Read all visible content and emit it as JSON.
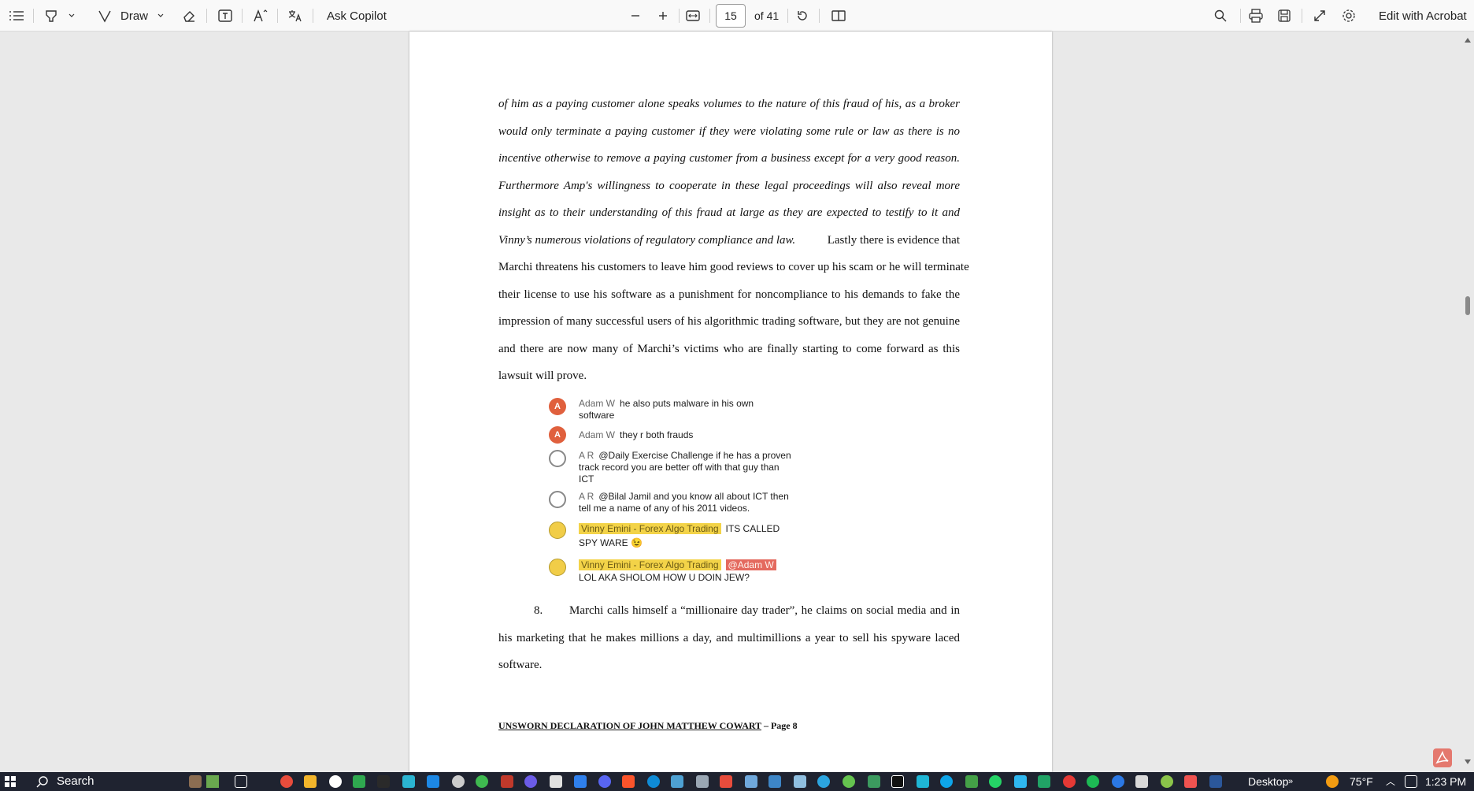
{
  "toolbar": {
    "draw_label": "Draw",
    "ask_copilot_label": "Ask Copilot",
    "page_number": "15",
    "page_total": "of 41",
    "edit_acrobat_label": "Edit with Acrobat"
  },
  "document": {
    "paragraph_lines": [
      {
        "text": "of him as a paying customer alone speaks volumes to the nature of this fraud of his, as a broker",
        "italic": true
      },
      {
        "text": "would only terminate a paying customer if they were violating some rule or law as there is no",
        "italic": true
      },
      {
        "text": "incentive otherwise to remove a paying customer from a business except for a very good reason.",
        "italic": true
      },
      {
        "text": "Furthermore Amp's willingness to cooperate in these legal proceedings will also reveal more",
        "italic": true
      },
      {
        "text": "insight as to their understanding of this fraud at large as they are expected to testify to it and",
        "italic": true
      }
    ],
    "mixed_line": {
      "italic_part": "Vinny’s numerous violations of regulatory compliance and law.",
      "normal_part": "Lastly there is evidence that"
    },
    "paragraph_lines_2": [
      "Marchi threatens his customers to leave him good reviews to cover up his scam or he will terminate",
      "their license to use his software as a punishment for noncompliance to his demands to fake the",
      "impression of many successful users of his algorithmic trading software, but they are not genuine",
      "and there are now many of Marchi’s victims who are finally starting to come forward as this",
      "lawsuit will prove."
    ],
    "chat": [
      {
        "avatar": "A",
        "avatar_style": "orange",
        "name": "Adam W",
        "lines": [
          "he also puts malware in his own",
          "software"
        ]
      },
      {
        "avatar": "A",
        "avatar_style": "orange",
        "name": "Adam W",
        "lines": [
          "they r both frauds"
        ]
      },
      {
        "avatar": "",
        "avatar_style": "ring",
        "name": "A R",
        "lines": [
          "@Daily Exercise Challenge if he has a proven",
          "track record you are better off with that guy than",
          "ICT"
        ]
      },
      {
        "avatar": "",
        "avatar_style": "ring",
        "name": "A R",
        "lines": [
          "@Bilal Jamil and you know all about ICT then",
          "tell me a name of any of his 2011 videos."
        ]
      },
      {
        "avatar": "",
        "avatar_style": "emoji",
        "tag": "Vinny Emini - Forex Algo Trading",
        "lines": [
          "ITS CALLED",
          "SPY WARE 😉"
        ]
      },
      {
        "avatar": "",
        "avatar_style": "emoji",
        "tag": "Vinny Emini - Forex Algo Trading",
        "mention": "@Adam W",
        "lines": [
          "LOL AKA SHOLOM HOW U DOIN JEW?"
        ]
      }
    ],
    "item8": {
      "number": "8.",
      "lines": [
        "Marchi calls himself a “millionaire  day trader”, he claims on social media and in",
        "his marketing that he makes millions a day, and multimillions  a year to sell his spyware laced",
        "software."
      ]
    },
    "footer": {
      "underlined": "UNSWORN  DECLARATION  OF  JOHN  MATTHEW  COWART",
      "suffix": "– Page 8"
    }
  },
  "taskbar": {
    "search_label": "Search",
    "desktop_label": "Desktop",
    "temperature": "75°F",
    "time": "1:23 PM"
  },
  "colors": {
    "accent_orange": "#e0603d",
    "highlight_yellow": "#f3d348",
    "mention_red": "#e46a5f",
    "taskbar_bg": "#1f2330"
  }
}
